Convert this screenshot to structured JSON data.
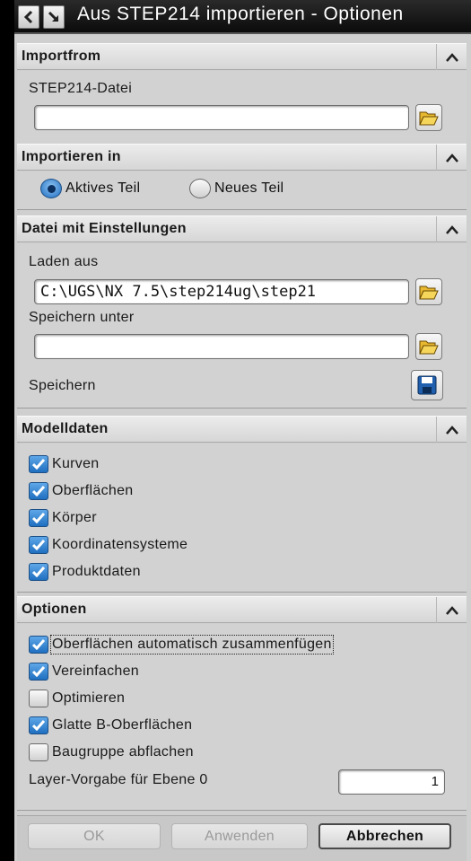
{
  "window": {
    "title": "Aus STEP214 importieren - Optionen"
  },
  "sections": {
    "importfrom": {
      "title": "Importfrom",
      "file_label": "STEP214-Datei",
      "file_value": ""
    },
    "importieren_in": {
      "title": "Importieren in",
      "options": [
        "Aktives Teil",
        "Neues Teil"
      ],
      "selected": "Aktives Teil"
    },
    "datei_einstellungen": {
      "title": "Datei mit Einstellungen",
      "laden_label": "Laden aus",
      "laden_value": "C:\\UGS\\NX 7.5\\step214ug\\step21",
      "speichern_unter_label": "Speichern unter",
      "speichern_unter_value": "",
      "speichern_label": "Speichern"
    },
    "modelldaten": {
      "title": "Modelldaten",
      "items": [
        {
          "label": "Kurven",
          "checked": true
        },
        {
          "label": "Oberflächen",
          "checked": true
        },
        {
          "label": "Körper",
          "checked": true
        },
        {
          "label": "Koordinatensysteme",
          "checked": true
        },
        {
          "label": "Produktdaten",
          "checked": true
        }
      ]
    },
    "optionen": {
      "title": "Optionen",
      "items": [
        {
          "label": "Oberflächen automatisch zusammenfügen",
          "checked": true
        },
        {
          "label": "Vereinfachen",
          "checked": true
        },
        {
          "label": "Optimieren",
          "checked": false
        },
        {
          "label": "Glatte B-Oberflächen",
          "checked": true
        },
        {
          "label": "Baugruppe abflachen",
          "checked": false
        }
      ],
      "layer_label": "Layer-Vorgabe für Ebene 0",
      "layer_value": "1"
    }
  },
  "buttons": {
    "ok": "OK",
    "apply": "Anwenden",
    "cancel": "Abbrechen"
  },
  "colors": {
    "checkbox_checked": "#1f6fc0",
    "panel_bg": "#d2d2d2",
    "titlebar_bg": "#0b0b0b"
  }
}
